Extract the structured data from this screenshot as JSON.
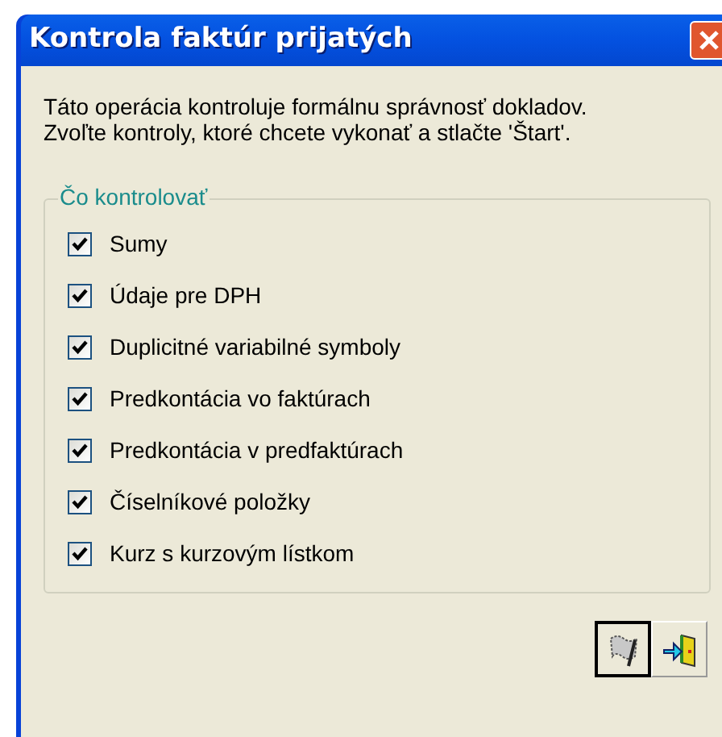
{
  "window": {
    "title": "Kontrola faktúr prijatých"
  },
  "intro": [
    "Táto operácia kontroluje formálnu správnosť dokladov.",
    "Zvoľte kontroly, ktoré chcete vykonať a stlačte 'Štart'."
  ],
  "group": {
    "title": "Čo kontrolovať",
    "items": [
      {
        "label": "Sumy",
        "checked": true
      },
      {
        "label": "Údaje pre DPH",
        "checked": true
      },
      {
        "label": "Duplicitné variabilné symboly",
        "checked": true
      },
      {
        "label": "Predkontácia vo faktúrach",
        "checked": true
      },
      {
        "label": "Predkontácia v predfaktúrach",
        "checked": true
      },
      {
        "label": "Číselníkové položky",
        "checked": true
      },
      {
        "label": "Kurz s kurzovým lístkom",
        "checked": true
      }
    ]
  }
}
